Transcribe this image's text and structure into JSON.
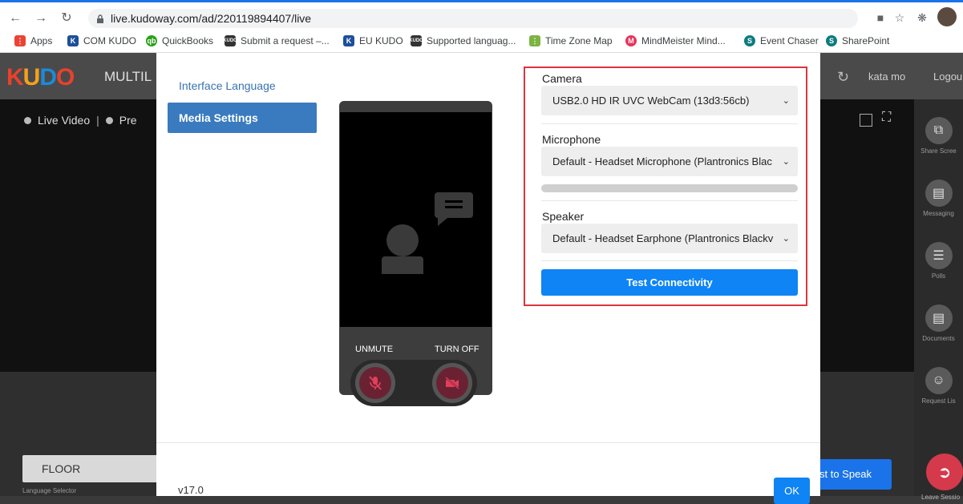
{
  "browser": {
    "url": "live.kudoway.com/ad/220119894407/live",
    "bookmarks": [
      {
        "label": "Apps",
        "icon": "apps-grid-icon",
        "color": "#ea4335"
      },
      {
        "label": "COM KUDO",
        "icon": "kudo-k-icon",
        "color": "#1c4f9c"
      },
      {
        "label": "QuickBooks",
        "icon": "quickbooks-icon",
        "color": "#2ca01c"
      },
      {
        "label": "Submit a request –...",
        "icon": "kudo-small-icon",
        "color": "#333333"
      },
      {
        "label": "EU KUDO",
        "icon": "kudo-k-icon",
        "color": "#1c4f9c"
      },
      {
        "label": "Supported languag...",
        "icon": "kudo-small-icon",
        "color": "#333333"
      },
      {
        "label": "Time Zone Map",
        "icon": "timezone-icon",
        "color": "#7cb342"
      },
      {
        "label": "MindMeister Mind...",
        "icon": "mindmeister-icon",
        "color": "#e8345a"
      },
      {
        "label": "Event Chaser",
        "icon": "sharepoint-icon",
        "color": "#0b7c80"
      },
      {
        "label": "SharePoint",
        "icon": "sharepoint-icon",
        "color": "#0b7c80"
      }
    ]
  },
  "app": {
    "logo": "KUDO",
    "title": "MULTIL",
    "user": "kata mo",
    "logout": "Logou",
    "live_video": "Live Video",
    "preview_tab": "Pre",
    "rail": [
      {
        "label": "Share Scree",
        "icon": "share-screen-icon"
      },
      {
        "label": "Messaging",
        "icon": "messaging-icon"
      },
      {
        "label": "Polls",
        "icon": "polls-icon"
      },
      {
        "label": "Documents",
        "icon": "documents-icon"
      },
      {
        "label": "Request Lis",
        "icon": "request-list-icon"
      }
    ],
    "floor": "FLOOR",
    "language_selector": "Language Selector",
    "request_to_speak": "st to Speak",
    "leave_session": "Leave Sessio"
  },
  "modal": {
    "nav": {
      "interface_language": "Interface Language",
      "media_settings": "Media Settings"
    },
    "preview": {
      "unmute": "UNMUTE",
      "turn_off": "TURN OFF"
    },
    "camera": {
      "label": "Camera",
      "value": "USB2.0 HD IR UVC WebCam (13d3:56cb)"
    },
    "microphone": {
      "label": "Microphone",
      "value": "Default - Headset Microphone (Plantronics Blac"
    },
    "speaker": {
      "label": "Speaker",
      "value": "Default - Headset Earphone (Plantronics Blackv"
    },
    "test_connectivity": "Test Connectivity",
    "version": "v17.0",
    "ok": "OK"
  },
  "colors": {
    "accent": "#0f84f4",
    "nav_active": "#3a7bbf",
    "highlight_border": "#d9363e",
    "leave": "#d43a4b"
  }
}
